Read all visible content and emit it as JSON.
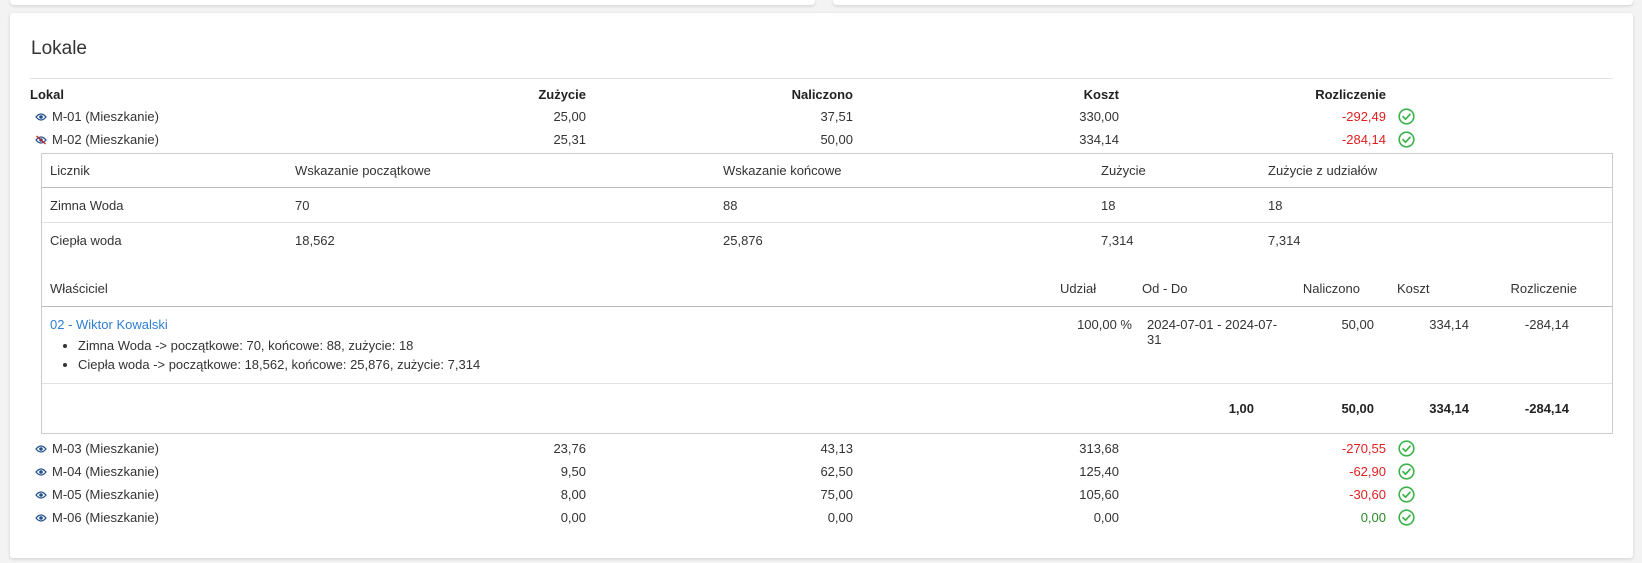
{
  "title": "Lokale",
  "headers": {
    "lokal": "Lokal",
    "zuzycie": "Zużycie",
    "naliczono": "Naliczono",
    "koszt": "Koszt",
    "rozliczenie": "Rozliczenie"
  },
  "units": [
    {
      "name": "M-01 (Mieszkanie)",
      "zuzycie": "25,00",
      "naliczono": "37,51",
      "koszt": "330,00",
      "rozliczenie": "-292,49",
      "expanded": false
    },
    {
      "name": "M-02 (Mieszkanie)",
      "zuzycie": "25,31",
      "naliczono": "50,00",
      "koszt": "334,14",
      "rozliczenie": "-284,14",
      "expanded": true
    }
  ],
  "units_after": [
    {
      "name": "M-03 (Mieszkanie)",
      "zuzycie": "23,76",
      "naliczono": "43,13",
      "koszt": "313,68",
      "rozliczenie": "-270,55"
    },
    {
      "name": "M-04 (Mieszkanie)",
      "zuzycie": "9,50",
      "naliczono": "62,50",
      "koszt": "125,40",
      "rozliczenie": "-62,90"
    },
    {
      "name": "M-05 (Mieszkanie)",
      "zuzycie": "8,00",
      "naliczono": "75,00",
      "koszt": "105,60",
      "rozliczenie": "-30,60"
    },
    {
      "name": "M-06 (Mieszkanie)",
      "zuzycie": "0,00",
      "naliczono": "0,00",
      "koszt": "0,00",
      "rozliczenie": "0,00"
    }
  ],
  "meters": {
    "headers": {
      "licznik": "Licznik",
      "start": "Wskazanie początkowe",
      "end": "Wskazanie końcowe",
      "usage": "Zużycie",
      "share_usage": "Zużycie z udziałów"
    },
    "rows": [
      {
        "licznik": "Zimna Woda",
        "start": "70",
        "end": "88",
        "usage": "18",
        "share_usage": "18"
      },
      {
        "licznik": "Ciepła woda",
        "start": "18,562",
        "end": "25,876",
        "usage": "7,314",
        "share_usage": "7,314"
      }
    ]
  },
  "owners": {
    "headers": {
      "owner": "Właściciel",
      "share": "Udział",
      "period": "Od - Do",
      "naliczono": "Naliczono",
      "koszt": "Koszt",
      "rozliczenie": "Rozliczenie"
    },
    "rows": [
      {
        "owner": "02 - Wiktor Kowalski",
        "items": [
          "Zimna Woda -> początkowe: 70, końcowe: 88, zużycie: 18",
          "Ciepła woda -> początkowe: 18,562, końcowe: 25,876, zużycie: 7,314"
        ],
        "share": "100,00 %",
        "period": "2024-07-01 - 2024-07-31",
        "naliczono": "50,00",
        "koszt": "334,14",
        "rozliczenie": "-284,14"
      }
    ],
    "summary": {
      "share": "1,00",
      "naliczono": "50,00",
      "koszt": "334,14",
      "rozliczenie": "-284,14"
    }
  },
  "colors": {
    "negative": "#e02020",
    "zero": "#2a8a2a",
    "check": "#3cb34a",
    "link": "#2f7fd3"
  },
  "icons": {
    "toggle_open": "eye-icon",
    "toggle_closed": "eye-slash-icon",
    "status": "check-circle-icon"
  }
}
